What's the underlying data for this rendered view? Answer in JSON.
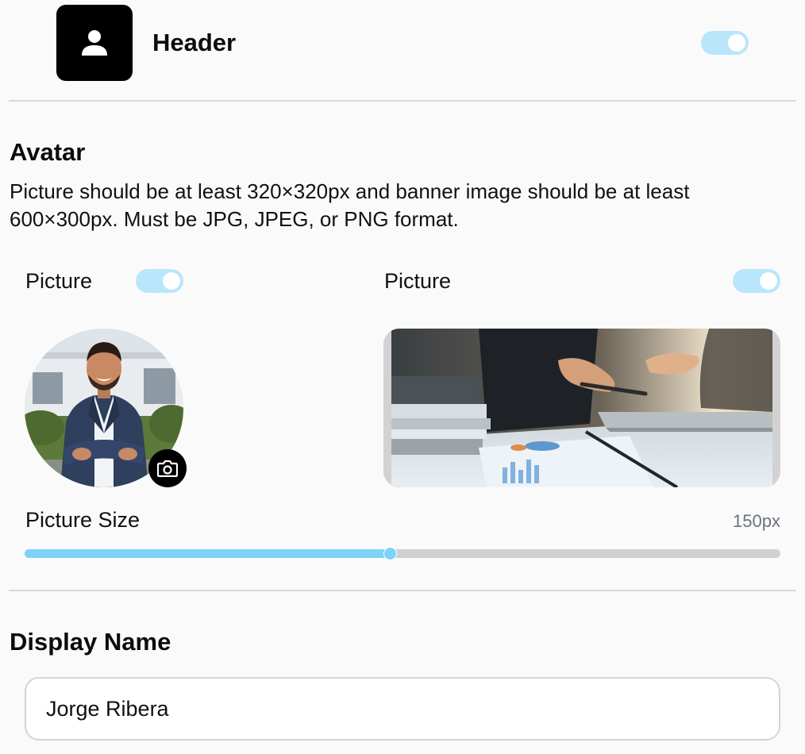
{
  "header": {
    "title": "Header",
    "icon": "user-icon",
    "toggle_on": true
  },
  "avatar_section": {
    "title": "Avatar",
    "description": "Picture should be at least 320×320px and banner image should be at least 600×300px. Must be JPG, JPEG, or PNG format.",
    "picture": {
      "label": "Picture",
      "toggle_on": true,
      "camera_icon": "camera-icon"
    },
    "banner": {
      "label": "Picture",
      "toggle_on": true
    },
    "size": {
      "label": "Picture Size",
      "value_text": "150px",
      "slider_fraction": 0.483
    }
  },
  "display_name": {
    "title": "Display Name",
    "value": "Jorge Ribera"
  },
  "colors": {
    "accent": "#7dd3f7",
    "toggle_track": "#b9e6fb",
    "text": "#0c0c0c",
    "muted": "#6b7280"
  }
}
